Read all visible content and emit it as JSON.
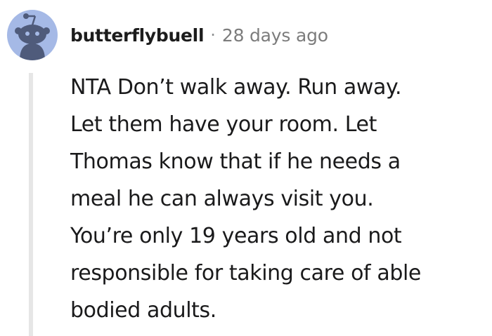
{
  "comment": {
    "username": "butterflybuell",
    "separator": "·",
    "timestamp": "28 days ago",
    "avatar_icon": "reddit-snoo-avatar-icon",
    "colors": {
      "avatar_bg": "#a5b9e6",
      "snoo_body": "#4f5b7b",
      "thread_line": "#e6e6e6",
      "timestamp": "#7c7c7c"
    },
    "body_lines": [
      "NTA Don’t walk away. Run away.",
      "Let them have your room. Let",
      "Thomas know that if he needs a",
      "meal he can always visit you.",
      "You’re only 19 years old and not",
      "responsible for taking care of able",
      "bodied adults."
    ]
  }
}
